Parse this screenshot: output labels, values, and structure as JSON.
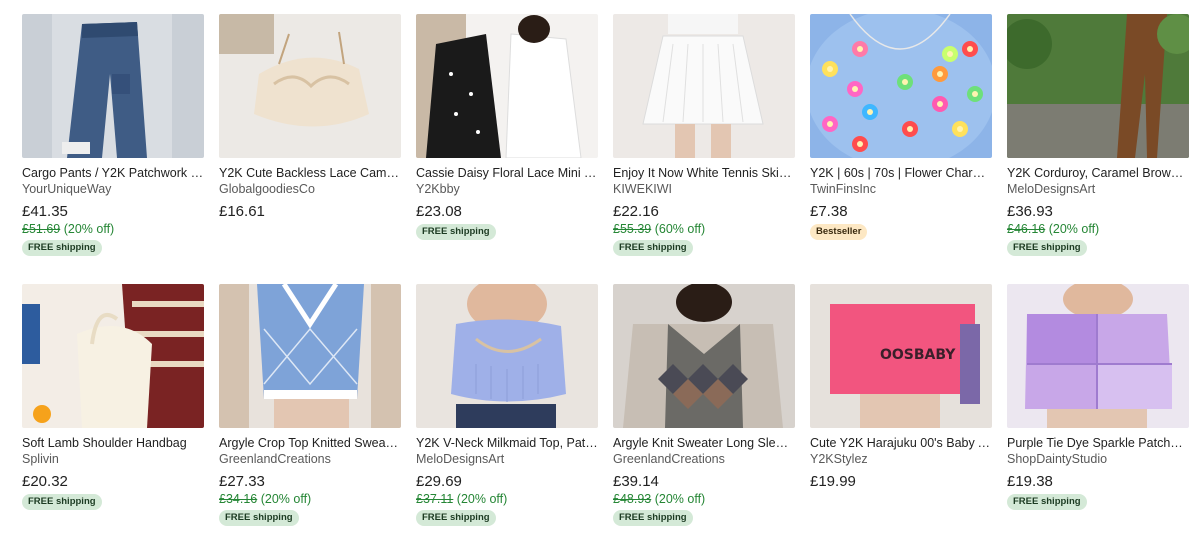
{
  "colors": {
    "discount": "#258635",
    "ship_badge": "#d4e9d7",
    "best_badge": "#fde8c4"
  },
  "rows": [
    [
      {
        "image": "cargo-jeans-photo",
        "title": "Cargo Pants / Y2K Patchwork B…",
        "shop": "YourUniqueWay",
        "price": "£41.35",
        "original": "£51.69",
        "discount": "(20% off)",
        "badge": "FREE shipping",
        "badge_type": "ship"
      },
      {
        "image": "lace-cami-photo",
        "title": "Y2K Cute Backless Lace Cami …",
        "shop": "GlobalgoodiesCo",
        "price": "£16.61",
        "original": "",
        "discount": "",
        "badge": "",
        "badge_type": ""
      },
      {
        "image": "floral-dress-photo",
        "title": "Cassie Daisy Floral Lace Mini Y…",
        "shop": "Y2Kbby",
        "price": "£23.08",
        "original": "",
        "discount": "",
        "badge": "FREE shipping",
        "badge_type": "ship"
      },
      {
        "image": "tennis-skirt-photo",
        "title": "Enjoy It Now White Tennis Skirt …",
        "shop": "KIWEKIWI",
        "price": "£22.16",
        "original": "£55.39",
        "discount": "(60% off)",
        "badge": "FREE shipping",
        "badge_type": "ship"
      },
      {
        "image": "flower-charm-photo",
        "title": "Y2K | 60s | 70s | Flower Charm …",
        "shop": "TwinFinsInc",
        "price": "£7.38",
        "original": "",
        "discount": "",
        "badge": "Bestseller",
        "badge_type": "best"
      },
      {
        "image": "corduroy-pants-photo",
        "title": "Y2K Corduroy, Caramel Brown …",
        "shop": "MeloDesignsArt",
        "price": "£36.93",
        "original": "£46.16",
        "discount": "(20% off)",
        "badge": "FREE shipping",
        "badge_type": "ship"
      }
    ],
    [
      {
        "image": "lamb-handbag-photo",
        "title": "Soft Lamb Shoulder Handbag",
        "shop": "Splivin",
        "price": "£20.32",
        "original": "",
        "discount": "",
        "badge": "FREE shipping",
        "badge_type": "ship"
      },
      {
        "image": "argyle-crop-photo",
        "title": "Argyle Crop Top Knitted Sweat…",
        "shop": "GreenlandCreations",
        "price": "£27.33",
        "original": "£34.16",
        "discount": "(20% off)",
        "badge": "FREE shipping",
        "badge_type": "ship"
      },
      {
        "image": "milkmaid-top-photo",
        "title": "Y2K V-Neck Milkmaid Top, Patc…",
        "shop": "MeloDesignsArt",
        "price": "£29.69",
        "original": "£37.11",
        "discount": "(20% off)",
        "badge": "FREE shipping",
        "badge_type": "ship"
      },
      {
        "image": "argyle-sweater-photo",
        "title": "Argyle Knit Sweater Long Sleev…",
        "shop": "GreenlandCreations",
        "price": "£39.14",
        "original": "£48.93",
        "discount": "(20% off)",
        "badge": "FREE shipping",
        "badge_type": "ship"
      },
      {
        "image": "harajuku-tee-photo",
        "title": "Cute Y2K Harajuku 00's Baby A…",
        "shop": "Y2KStylez",
        "price": "£19.99",
        "original": "",
        "discount": "",
        "badge": "",
        "badge_type": ""
      },
      {
        "image": "tie-dye-top-photo",
        "title": "Purple Tie Dye Sparkle Patchw…",
        "shop": "ShopDaintyStudio",
        "price": "£19.38",
        "original": "",
        "discount": "",
        "badge": "FREE shipping",
        "badge_type": "ship"
      }
    ]
  ]
}
